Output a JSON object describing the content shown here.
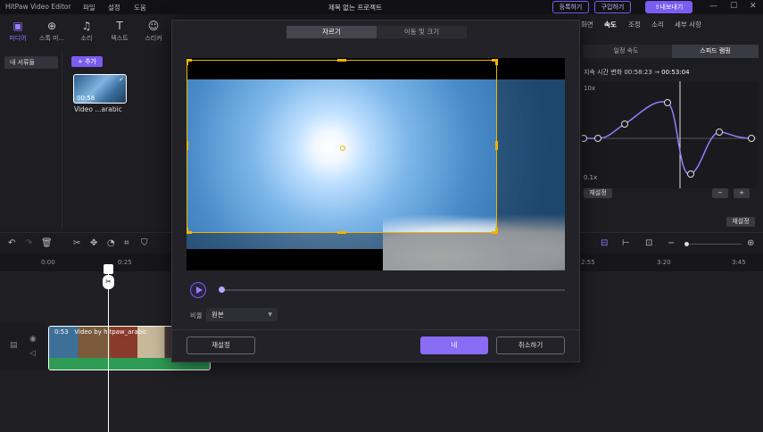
{
  "app_title": "HitPaw Video Editor",
  "menu": [
    "파일",
    "설정",
    "도움"
  ],
  "project_title": "제목 없는 프로젝트",
  "titlebar_buttons": {
    "register": "등록하기",
    "buy": "구입하기",
    "export": "내보내기"
  },
  "toolbar": [
    {
      "label": "미디어",
      "icon": "media-icon"
    },
    {
      "label": "스톡 미...",
      "icon": "globe-icon"
    },
    {
      "label": "소리",
      "icon": "music-icon"
    },
    {
      "label": "텍스트",
      "icon": "text-icon"
    },
    {
      "label": "스티커",
      "icon": "sticker-icon"
    }
  ],
  "sidebar": {
    "my_files": "내 서류들"
  },
  "media": {
    "add_label": "+ 추가",
    "clip_duration": "00:58",
    "clip_name": "Video ...arabic"
  },
  "timeline": {
    "ruler_ticks": [
      "0:00",
      "0:25",
      "2:55",
      "3:20",
      "3:45"
    ],
    "clip_duration": "0:53",
    "clip_label": "Video by hitpaw_arabic"
  },
  "right_panel": {
    "tabs": [
      "화면",
      "속도",
      "조정",
      "소리",
      "세부 사항"
    ],
    "active_tab": "속도",
    "speed_modes": [
      "일정 속도",
      "스피드 램핑"
    ],
    "duration_change_label": "지속 시간 변화",
    "duration_from": "00:58:23",
    "arrow": "→",
    "duration_to": "00:53:04",
    "graph_top_label": "10x",
    "graph_bottom_label": "0.1x",
    "reset_label": "재설정",
    "minus": "−",
    "plus": "+",
    "reset_bottom": "재설정"
  },
  "crop_modal": {
    "tabs": [
      "자르기",
      "이동 및 크기"
    ],
    "ratio_label": "비율",
    "ratio_value": "원본",
    "reset_button": "재설정",
    "ok_button": "네",
    "cancel_button": "취소하기"
  },
  "colors": {
    "accent": "#7b5cf0",
    "crop": "#f0b400",
    "audio": "#2e9c55"
  }
}
